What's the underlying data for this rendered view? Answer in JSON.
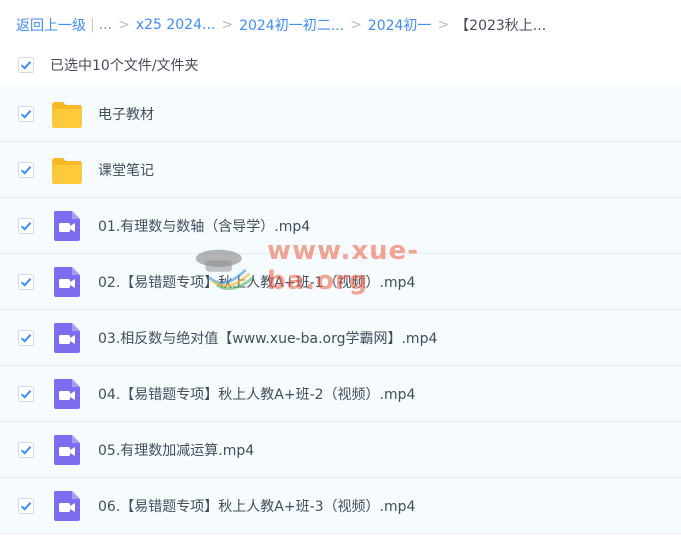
{
  "breadcrumb": {
    "back_label": "返回上一级",
    "ellipsis": "...",
    "items": [
      "x25 2024...",
      "2024初一初二...",
      "2024初一"
    ],
    "current": "【2023秋上..."
  },
  "selection": {
    "label": "已选中10个文件/文件夹"
  },
  "files": [
    {
      "name": "电子教材",
      "type": "folder-icon"
    },
    {
      "name": "课堂笔记",
      "type": "folder-icon"
    },
    {
      "name": "01.有理数与数轴（含导学）.mp4",
      "type": "video-file-icon"
    },
    {
      "name": "02.【易错题专项】秋上人教A+班-1（视频）.mp4",
      "type": "video-file-icon"
    },
    {
      "name": "03.相反数与绝对值【www.xue-ba.org学霸网】.mp4",
      "type": "video-file-icon"
    },
    {
      "name": "04.【易错题专项】秋上人教A+班-2（视频）.mp4",
      "type": "video-file-icon"
    },
    {
      "name": "05.有理数加减运算.mp4",
      "type": "video-file-icon"
    },
    {
      "name": "06.【易错题专项】秋上人教A+班-3（视频）.mp4",
      "type": "video-file-icon"
    }
  ],
  "watermark": {
    "text": "www.xue-ba.org"
  },
  "colors": {
    "accent": "#3f8cff",
    "row_background": "#f5fbff",
    "folder": "#ffc93c",
    "video": "#7b6cf0"
  }
}
